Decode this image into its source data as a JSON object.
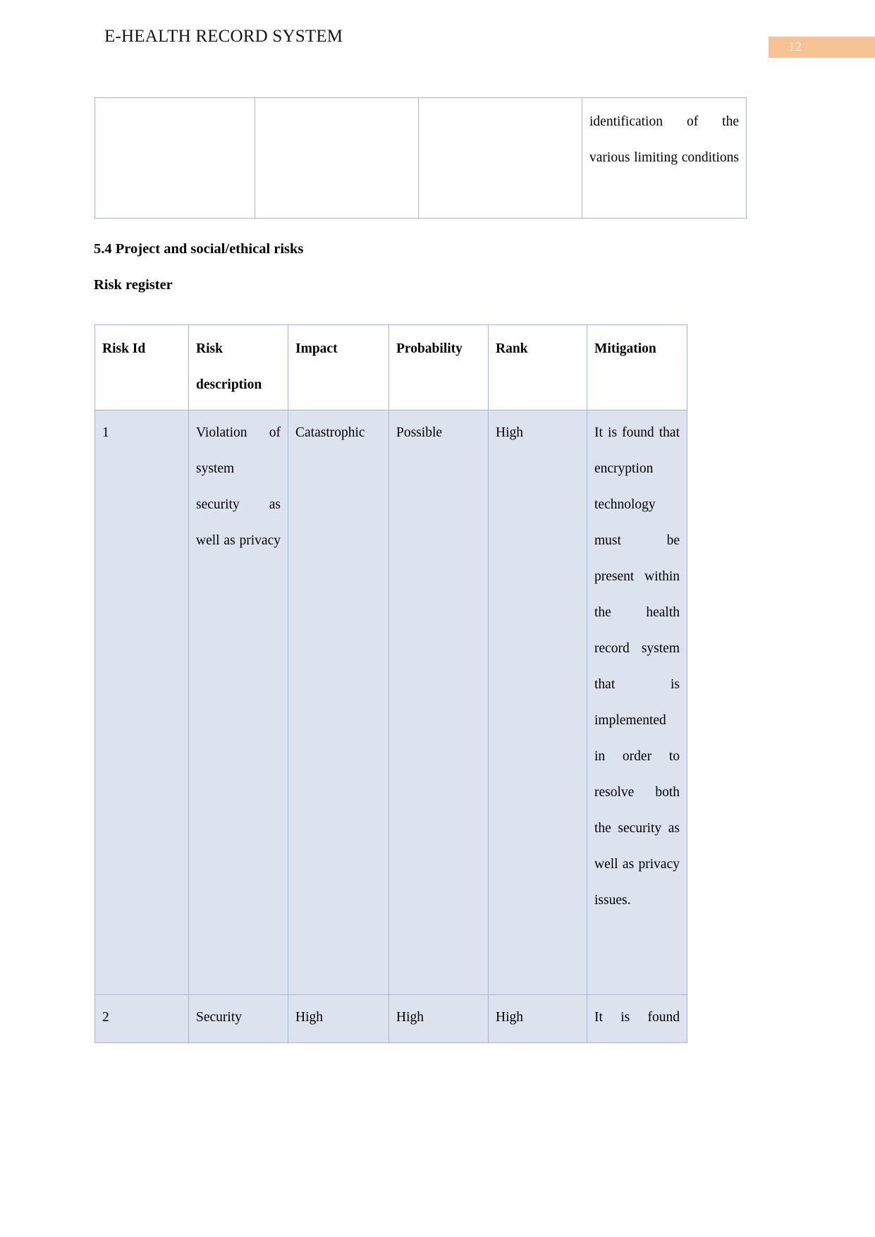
{
  "document": {
    "header_title": "E-HEALTH RECORD SYSTEM",
    "page_number": "12"
  },
  "headings": {
    "section": "5.4 Project and social/ethical risks",
    "subsection": "Risk register"
  },
  "top_table": {
    "cells": [
      "",
      "",
      "",
      "identification of the various limiting conditions"
    ]
  },
  "risk_table": {
    "headers": [
      "Risk Id",
      "Risk description",
      "Impact",
      "Probability",
      "Rank",
      "Mitigation"
    ],
    "rows": [
      {
        "risk_id": "1",
        "risk_description": "Violation of system security as well as privacy",
        "impact": "Catastrophic",
        "probability": "Possible",
        "rank": "High",
        "mitigation": "It is found that encryption technology must be present within the health record system that is implemented in order to resolve both the security as well as privacy issues."
      },
      {
        "risk_id": "2",
        "risk_description": "Security",
        "impact": "High",
        "probability": "High",
        "rank": "High",
        "mitigation": "It is found"
      }
    ]
  },
  "colors": {
    "page_badge_bg": "#f7c394",
    "page_badge_text": "#fdf3e8",
    "table_border": "#a6b8d4",
    "row_shade": "#dce3ef",
    "rank_high": "#fe0000"
  }
}
